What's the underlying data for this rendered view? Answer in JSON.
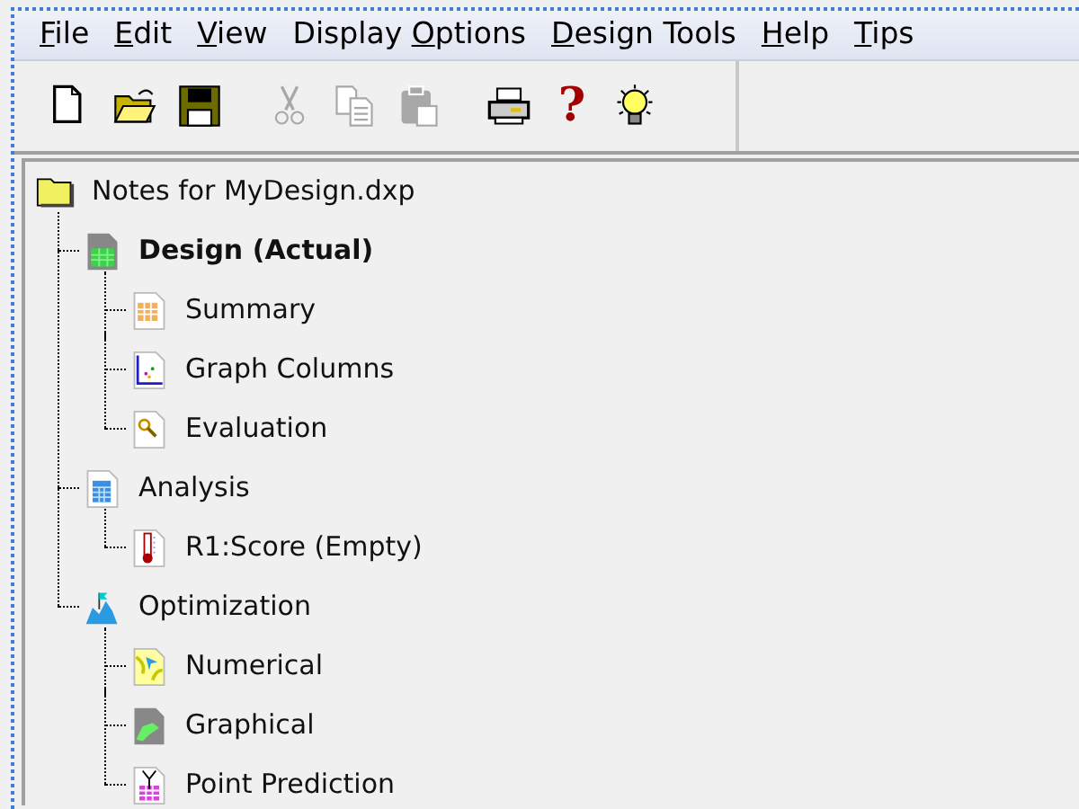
{
  "menu": [
    {
      "key": "F",
      "after": "ile"
    },
    {
      "key": "E",
      "after": "dit"
    },
    {
      "key": "V",
      "after": "iew"
    },
    {
      "before": "Display ",
      "key": "O",
      "after": "ptions"
    },
    {
      "key": "D",
      "after": "esign Tools"
    },
    {
      "key": "H",
      "after": "elp"
    },
    {
      "key": "T",
      "after": "ips"
    }
  ],
  "toolbar": [
    {
      "kind": "new",
      "disabled": false
    },
    {
      "kind": "open",
      "disabled": false
    },
    {
      "kind": "save",
      "disabled": false
    },
    {
      "kind": "cut",
      "disabled": true
    },
    {
      "kind": "copy",
      "disabled": true
    },
    {
      "kind": "paste",
      "disabled": true
    },
    {
      "kind": "print",
      "disabled": false
    },
    {
      "kind": "help",
      "glyph": "?",
      "disabled": false
    },
    {
      "kind": "tip",
      "disabled": false
    }
  ],
  "tree": {
    "label": "Notes for MyDesign.dxp",
    "kind": "folder",
    "bold": false,
    "children": [
      {
        "label": "Design (Actual)",
        "kind": "design",
        "bold": true,
        "children": [
          {
            "label": "Summary",
            "kind": "summary",
            "bold": false
          },
          {
            "label": "Graph Columns",
            "kind": "graph",
            "bold": false
          },
          {
            "label": "Evaluation",
            "kind": "evaluation",
            "bold": false
          }
        ]
      },
      {
        "label": "Analysis",
        "kind": "analysis",
        "bold": false,
        "children": [
          {
            "label": "R1:Score (Empty)",
            "kind": "response",
            "bold": false
          }
        ]
      },
      {
        "label": "Optimization",
        "kind": "optimization",
        "bold": false,
        "children": [
          {
            "label": "Numerical",
            "kind": "numerical",
            "bold": false
          },
          {
            "label": "Graphical",
            "kind": "graphical",
            "bold": false
          },
          {
            "label": "Point Prediction",
            "kind": "prediction",
            "bold": false
          }
        ]
      }
    ]
  }
}
